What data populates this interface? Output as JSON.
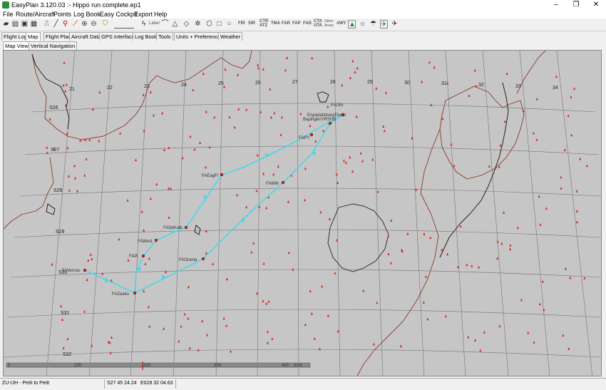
{
  "window": {
    "title": "EasyPlan 3.120.03 :- Hippo run complete.ep1",
    "minimize": "–",
    "maximize": "❐",
    "close": "✕"
  },
  "menu": [
    "File",
    "Route/Aircraft",
    "Points",
    "Log Book",
    "Easy Cockpit",
    "Export",
    "Help"
  ],
  "toolbar": {
    "label_text": "Label",
    "fir": "FIR",
    "sir": "SIR",
    "ctr_atz": "CTR\nATZ",
    "tma": "TMA",
    "far": "FAR",
    "fap": "FAP",
    "fad": "FAD",
    "cta_uta": "CTA\nUTA",
    "other_areas": "Other\nAreas",
    "awy": "AWY"
  },
  "tabs": [
    "Flight Log",
    "Map",
    "Flight Plan",
    "Aircraft Data",
    "GPS Interface",
    "Log Book",
    "Tools",
    "Units + Preferences",
    "Weather"
  ],
  "active_tab": "Map",
  "subtabs": [
    "Map View",
    "Vertical Navigation"
  ],
  "active_subtab": "Map View",
  "map": {
    "lon_labels": [
      "21",
      "22",
      "23",
      "24",
      "25",
      "26",
      "27",
      "28",
      "29",
      "30",
      "31",
      "32",
      "33",
      "34"
    ],
    "lat_labels": [
      "S26",
      "S27",
      "S28",
      "S29",
      "S30",
      "S31",
      "S32"
    ],
    "waypoints": [
      "FAGM",
      "Ergoplatzburg/Dwen",
      "Bapinger/VRSHB",
      "FAPY",
      "FAEagFt",
      "FAWM",
      "FADeKalk",
      "FAWest",
      "FAPi",
      "FAOrania",
      "FAVernas",
      "FAZeeko"
    ],
    "scale": {
      "labels": [
        "0",
        "100",
        "200",
        "300",
        "400"
      ],
      "unit": "(nm)"
    },
    "route_color": "#4cd6e8",
    "border_color": "#8b3a2a",
    "marker_color": "#d42a2a"
  },
  "status": {
    "aircraft_leg": "ZU-IJH  -  Petit to Petit",
    "lat": "S27 45 24.24",
    "lon": "E028 32 04.63"
  }
}
